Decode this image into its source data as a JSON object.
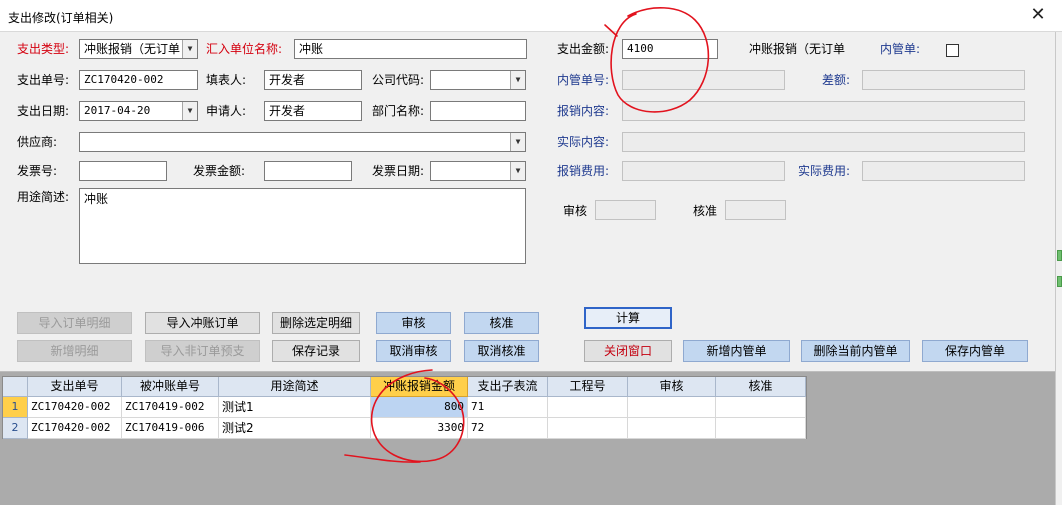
{
  "window": {
    "title": "支出修改(订单相关)",
    "close_glyph": "✕"
  },
  "form": {
    "expense_type": {
      "label": "支出类型:",
      "value": "冲账报销（无订单",
      "dropdown_glyph": "▼"
    },
    "remit_unit": {
      "label": "汇入单位名称:",
      "value": "冲账"
    },
    "amount": {
      "label": "支出金额:",
      "value": "4100"
    },
    "offset_note": {
      "text": "冲账报销（无订单"
    },
    "internal_order": {
      "label": "内管单:",
      "checked": false
    },
    "expense_no": {
      "label": "支出单号:",
      "value": "ZC170420-002"
    },
    "filler": {
      "label": "填表人:",
      "value": "开发者"
    },
    "company_code": {
      "label": "公司代码:",
      "value": ""
    },
    "internal_no": {
      "label": "内管单号:",
      "value": ""
    },
    "difference": {
      "label": "差额:",
      "value": ""
    },
    "expense_date": {
      "label": "支出日期:",
      "value": "2017-04-20"
    },
    "applicant": {
      "label": "申请人:",
      "value": "开发者"
    },
    "department": {
      "label": "部门名称:",
      "value": ""
    },
    "claim_content": {
      "label": "报销内容:",
      "value": ""
    },
    "supplier": {
      "label": "供应商:",
      "value": ""
    },
    "actual_content": {
      "label": "实际内容:",
      "value": ""
    },
    "invoice_no": {
      "label": "发票号:",
      "value": ""
    },
    "invoice_amount": {
      "label": "发票金额:",
      "value": ""
    },
    "invoice_date": {
      "label": "发票日期:",
      "value": ""
    },
    "claim_fee": {
      "label": "报销费用:",
      "value": ""
    },
    "actual_fee": {
      "label": "实际费用:",
      "value": ""
    },
    "purpose": {
      "label": "用途简述:",
      "value": "冲账"
    },
    "review": {
      "label": "审核",
      "value": ""
    },
    "approve": {
      "label": "核准",
      "value": ""
    }
  },
  "buttons": {
    "import_order_detail": "导入订单明细",
    "import_offset_order": "导入冲账订单",
    "delete_selected": "删除选定明细",
    "review": "审核",
    "approve": "核准",
    "calculate": "计算",
    "add_detail": "新增明细",
    "import_non_order": "导入非订单预支",
    "save_record": "保存记录",
    "cancel_review": "取消审核",
    "cancel_approve": "取消核准",
    "close_window": "关闭窗口",
    "add_internal": "新增内管单",
    "delete_internal": "删除当前内管单",
    "save_internal": "保存内管单"
  },
  "grid": {
    "columns": [
      "支出单号",
      "被冲账单号",
      "用途简述",
      "冲账报销金额",
      "支出子表流",
      "工程号",
      "审核",
      "核准"
    ],
    "rows": [
      {
        "index": "1",
        "cells": [
          "ZC170420-002",
          "ZC170419-002",
          "测试1",
          "800",
          "71",
          "",
          "",
          ""
        ]
      },
      {
        "index": "2",
        "cells": [
          "ZC170420-002",
          "ZC170419-006",
          "测试2",
          "3300",
          "72",
          "",
          "",
          ""
        ]
      }
    ]
  }
}
